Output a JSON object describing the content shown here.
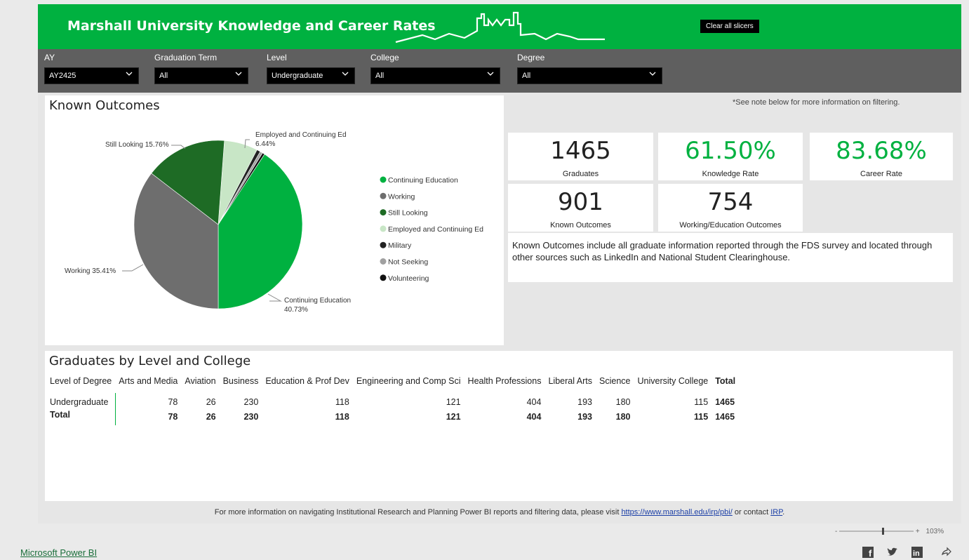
{
  "header": {
    "title": "Marshall University Knowledge and Career Rates",
    "clear_button": "Clear all slicers",
    "accent": "#00b140"
  },
  "slicers": [
    {
      "label": "AY",
      "value": "AY2425"
    },
    {
      "label": "Graduation Term",
      "value": "All"
    },
    {
      "label": "Level",
      "value": "Undergraduate"
    },
    {
      "label": "College",
      "value": "All"
    },
    {
      "label": "Degree",
      "value": "All"
    }
  ],
  "note_filter": "*See note below for more information on filtering.",
  "known_outcomes": {
    "title": "Known Outcomes",
    "legend": [
      "Continuing Education",
      "Working",
      "Still Looking",
      "Employed and Continuing Ed",
      "Military",
      "Not Seeking",
      "Volunteering"
    ],
    "labels": {
      "still_looking": "Still Looking 15.76%",
      "employed_ce_1": "Employed and Continuing Ed",
      "employed_ce_2": "6.44%",
      "working": "Working 35.41%",
      "continuing_1": "Continuing Education",
      "continuing_2": "40.73%"
    }
  },
  "chart_data": {
    "type": "pie",
    "title": "Known Outcomes",
    "categories": [
      "Continuing Education",
      "Working",
      "Still Looking",
      "Employed and Continuing Ed",
      "Military",
      "Not Seeking",
      "Volunteering"
    ],
    "values": [
      40.73,
      35.41,
      15.76,
      6.44,
      0.7,
      0.5,
      0.46
    ],
    "colors": [
      "#00b140",
      "#6e6e6e",
      "#1e6b25",
      "#c8e6c6",
      "#222222",
      "#a0a0a0",
      "#111111"
    ],
    "legend_position": "right"
  },
  "cards": [
    {
      "value": "1465",
      "label": "Graduates",
      "green": false
    },
    {
      "value": "61.50%",
      "label": "Knowledge Rate",
      "green": true
    },
    {
      "value": "83.68%",
      "label": "Career Rate",
      "green": true
    },
    {
      "value": "901",
      "label": "Known Outcomes",
      "green": false
    },
    {
      "value": "754",
      "label": "Working/Education Outcomes",
      "green": false
    }
  ],
  "info_text": "Known Outcomes include all graduate information reported through the FDS survey and located through other sources such as LinkedIn and National Student Clearinghouse.",
  "grads_table": {
    "title": "Graduates by Level and College",
    "columns": [
      "Level of Degree",
      "Arts and Media",
      "Aviation",
      "Business",
      "Education & Prof Dev",
      "Engineering and Comp Sci",
      "Health Professions",
      "Liberal Arts",
      "Science",
      "University College",
      "Total"
    ],
    "rows": [
      [
        "Undergraduate",
        "78",
        "26",
        "230",
        "118",
        "121",
        "404",
        "193",
        "180",
        "115",
        "1465"
      ],
      [
        "Total",
        "78",
        "26",
        "230",
        "118",
        "121",
        "404",
        "193",
        "180",
        "115",
        "1465"
      ]
    ]
  },
  "footer": {
    "text_before": "For more information on navigating Institutional Research and Planning Power BI reports and filtering data, please visit ",
    "link": "https://www.marshall.edu/irp/pbi/",
    "text_middle": " or contact ",
    "contact": "IRP",
    "text_after": "."
  },
  "bottom": {
    "powerbi_link": "Microsoft Power BI",
    "zoom": "103%",
    "zoom_minus": "-",
    "zoom_plus": "+"
  }
}
